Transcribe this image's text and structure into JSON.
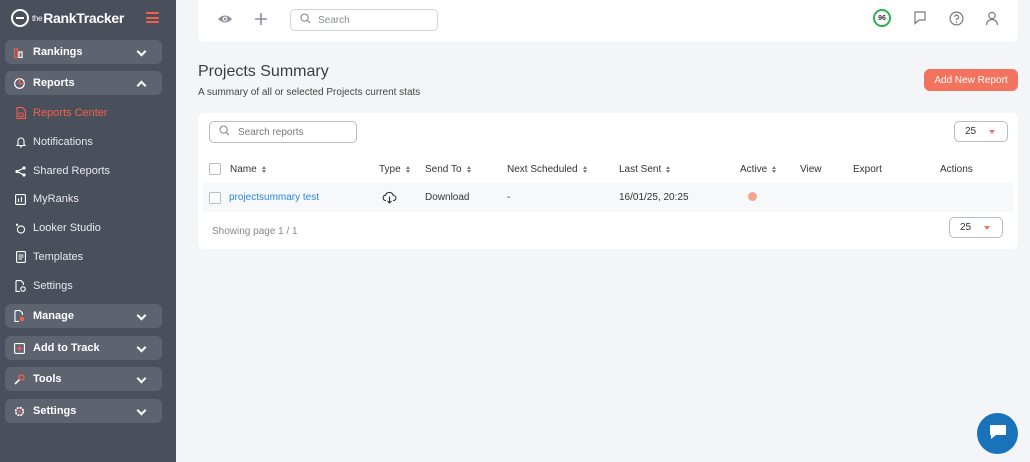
{
  "app": {
    "logo_prefix": "the",
    "logo_name": "RankTracker"
  },
  "sidebar": {
    "groups": {
      "rankings": "Rankings",
      "reports": "Reports",
      "manage": "Manage",
      "add_to_track": "Add to Track",
      "tools": "Tools",
      "settings": "Settings"
    },
    "report_items": {
      "reports_center": "Reports Center",
      "notifications": "Notifications",
      "shared_reports": "Shared Reports",
      "myranks": "MyRanks",
      "looker_studio": "Looker Studio",
      "templates": "Templates",
      "settings": "Settings"
    }
  },
  "topbar": {
    "search_placeholder": "Search",
    "score": "96"
  },
  "header": {
    "title": "Projects Summary",
    "subtitle": "A summary of all or selected Projects current stats",
    "add_button": "Add New Report"
  },
  "reports": {
    "search_placeholder": "Search reports",
    "page_size": "25",
    "columns": {
      "name": "Name",
      "type": "Type",
      "send_to": "Send To",
      "next_scheduled": "Next Scheduled",
      "last_sent": "Last Sent",
      "active": "Active",
      "view": "View",
      "export": "Export",
      "actions": "Actions"
    },
    "rows": [
      {
        "name": "projectsummary test",
        "type_icon": "cloud-download-icon",
        "send_to": "Download",
        "next_scheduled": "-",
        "last_sent": "16/01/25, 20:25",
        "active_color": "#f4a593"
      }
    ],
    "showing": "Showing page 1 / 1"
  },
  "colors": {
    "accent": "#f0624f",
    "button": "#f4735f",
    "sidebar": "#4a4f5c",
    "link": "#2e86de",
    "chat": "#1a73b8",
    "score_ring": "#2ab24d"
  }
}
